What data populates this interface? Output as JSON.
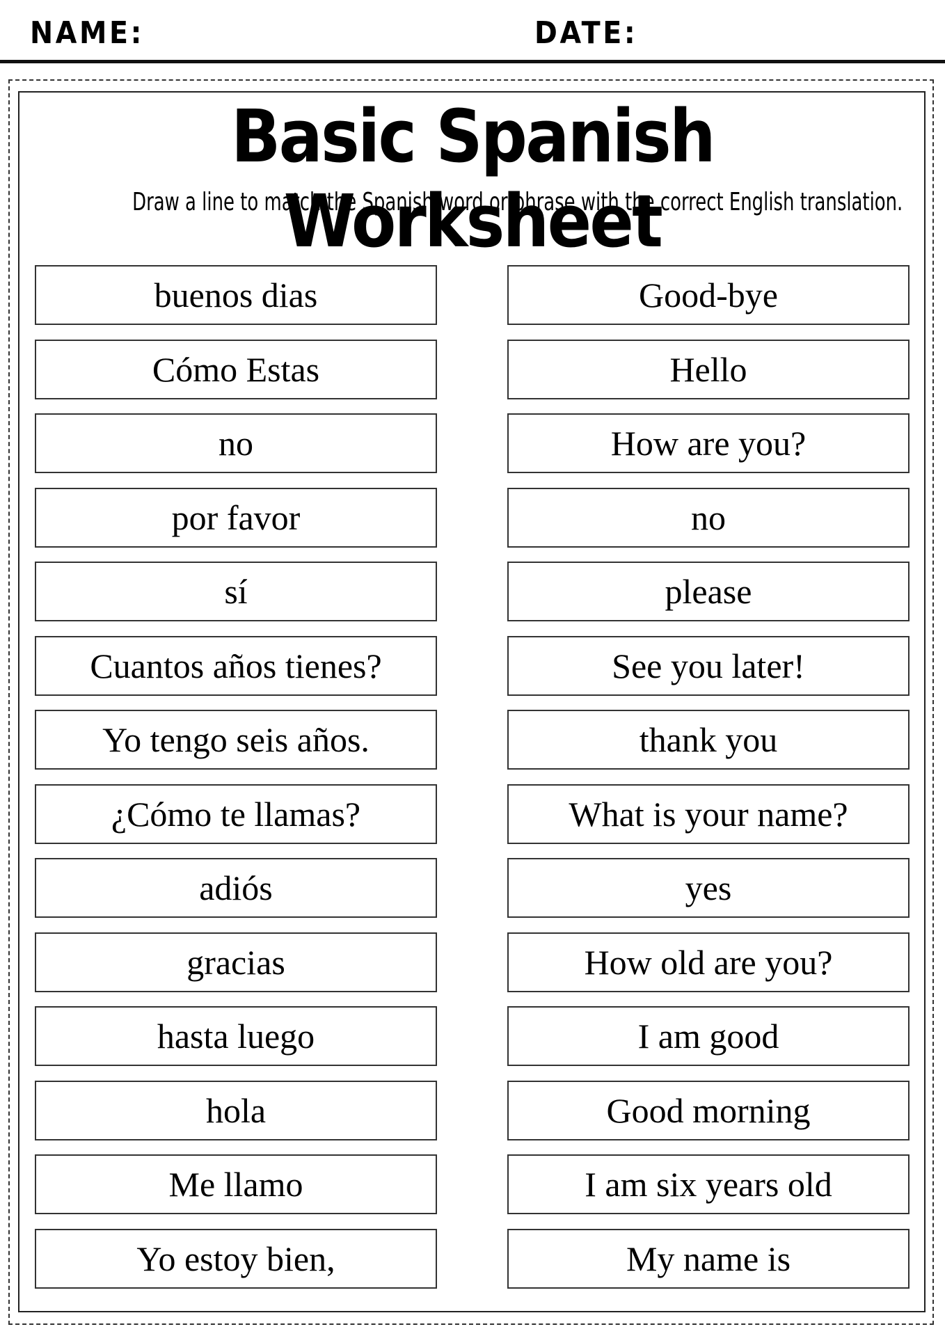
{
  "header": {
    "name_label": "NAME:",
    "date_label": "DATE:"
  },
  "title": "Basic Spanish Worksheet",
  "instructions": "Draw a line to match the Spanish word or phrase with the correct English translation.",
  "spanish": [
    "buenos dias",
    "Cómo Estas",
    "no",
    "por favor",
    "sí",
    "Cuantos años tienes?",
    "Yo tengo seis años.",
    "¿Cómo te llamas?",
    "adiós",
    "gracias",
    "hasta luego",
    "hola",
    "Me llamo",
    "Yo estoy bien,"
  ],
  "english": [
    "Good-bye",
    "Hello",
    "How are you?",
    "no",
    "please",
    "See you later!",
    "thank you",
    "What is your name?",
    "yes",
    "How old are you?",
    "I am good",
    "Good morning",
    "I am six years old",
    "My name is"
  ]
}
